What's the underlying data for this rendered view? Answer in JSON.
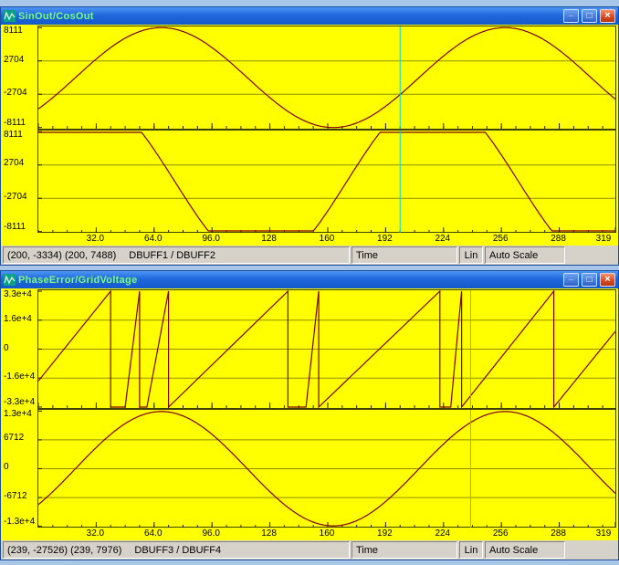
{
  "colors": {
    "desktop_background": "#a8c6e8",
    "titlebar_text": "#7dfc7d",
    "plot_background": "#ffff00",
    "waveform": "#7f0000",
    "grid": "#8f8f00",
    "cursor": "#00dcdc"
  },
  "window_controls": {
    "minimize_glyph": "_",
    "maximize_glyph": "□",
    "close_glyph": "×"
  },
  "windows": [
    {
      "title": "SinOut/CosOut",
      "status": {
        "cursor_readout": "(200, -3334) (200, 7488)",
        "buffers": "DBUFF1 / DBUFF2",
        "domain_mode": "Time",
        "scale_mode": "Lin",
        "autoscale_mode": "Auto Scale"
      }
    },
    {
      "title": "PhaseError/GridVoltage",
      "status": {
        "cursor_readout": "(239, -27526) (239, 7976)",
        "buffers": "DBUFF3 / DBUFF4",
        "domain_mode": "Time",
        "scale_mode": "Lin",
        "autoscale_mode": "Auto Scale"
      }
    }
  ],
  "chart_data": [
    {
      "type": "line",
      "window": "SinOut/CosOut",
      "subplot": "upper",
      "x_range": [
        0,
        319
      ],
      "y_range": [
        -8300,
        8300
      ],
      "y_ticks": [
        {
          "value": 8111,
          "label": "8111"
        },
        {
          "value": 2704,
          "label": "2704"
        },
        {
          "value": -2704,
          "label": "-2704"
        },
        {
          "value": -8111,
          "label": "-8111"
        }
      ],
      "grid_values": [
        2704,
        -2704
      ],
      "x_minor_step": 8,
      "x_major_step": 32,
      "cursor_x": 200,
      "grid_color": "#8f8f00",
      "cursor_color": "#00dcdc",
      "series": [
        {
          "name": "DBUFF1",
          "color": "#7f0000",
          "waveform": {
            "shape": "cosine",
            "amplitude": 8111,
            "period": 190,
            "peak_x": 68
          }
        }
      ]
    },
    {
      "type": "line",
      "window": "SinOut/CosOut",
      "subplot": "lower",
      "x_range": [
        0,
        319
      ],
      "y_range": [
        -8300,
        8300
      ],
      "y_ticks": [
        {
          "value": 8111,
          "label": "8111"
        },
        {
          "value": 2704,
          "label": "2704"
        },
        {
          "value": -2704,
          "label": "-2704"
        },
        {
          "value": -8111,
          "label": "-8111"
        }
      ],
      "grid_values": [
        2704,
        -2704
      ],
      "x_minor_step": 8,
      "cursor_x": 200,
      "grid_color": "#8f8f00",
      "cursor_color": "#00dcdc",
      "x_ticks": [
        {
          "value": 32,
          "label": "32.0"
        },
        {
          "value": 64,
          "label": "64.0"
        },
        {
          "value": 96,
          "label": "96.0"
        },
        {
          "value": 128,
          "label": "128"
        },
        {
          "value": 160,
          "label": "160"
        },
        {
          "value": 192,
          "label": "192"
        },
        {
          "value": 224,
          "label": "224"
        },
        {
          "value": 256,
          "label": "256"
        },
        {
          "value": 288,
          "label": "288"
        },
        {
          "value": 319,
          "label": "319"
        }
      ],
      "series": [
        {
          "name": "DBUFF2",
          "color": "#7f0000",
          "waveform": {
            "shape": "cosine",
            "amplitude": 14000,
            "period": 190,
            "peak_x": 28,
            "clip": 8000
          }
        }
      ]
    },
    {
      "type": "line",
      "window": "PhaseError/GridVoltage",
      "subplot": "upper",
      "x_range": [
        0,
        319
      ],
      "y_range": [
        -33300,
        33300
      ],
      "y_ticks": [
        {
          "value": 32768,
          "label": "3.3e+4"
        },
        {
          "value": 16384,
          "label": "1.6e+4"
        },
        {
          "value": 0,
          "label": "0"
        },
        {
          "value": -16384,
          "label": "-1.6e+4"
        },
        {
          "value": -32768,
          "label": "-3.3e+4"
        }
      ],
      "grid_values": [
        16384,
        0,
        -16384
      ],
      "x_minor_step": 8,
      "x_major_step": 32,
      "cursor_x": 239,
      "grid_color": "#8f8f00",
      "cursor_color": "#00dcdc",
      "series": [
        {
          "name": "DBUFF3",
          "color": "#7f0000",
          "points": [
            [
              0,
              -18000
            ],
            [
              40,
              32768
            ],
            [
              40,
              -32768
            ],
            [
              48,
              -32768
            ],
            [
              56,
              32768
            ],
            [
              56,
              -32768
            ],
            [
              60,
              -32768
            ],
            [
              72,
              32768
            ],
            [
              72,
              -32768
            ],
            [
              138,
              32768
            ],
            [
              138,
              -32768
            ],
            [
              148,
              -32768
            ],
            [
              155,
              32768
            ],
            [
              155,
              -32768
            ],
            [
              222,
              32768
            ],
            [
              222,
              -32768
            ],
            [
              228,
              -32768
            ],
            [
              234,
              32768
            ],
            [
              234,
              -32768
            ],
            [
              285,
              32768
            ],
            [
              285,
              -32768
            ],
            [
              319,
              10000
            ]
          ]
        }
      ]
    },
    {
      "type": "line",
      "window": "PhaseError/GridVoltage",
      "subplot": "lower",
      "x_range": [
        0,
        319
      ],
      "y_range": [
        -13700,
        13700
      ],
      "y_ticks": [
        {
          "value": 13424,
          "label": "1.3e+4"
        },
        {
          "value": 6712,
          "label": "6712"
        },
        {
          "value": 0,
          "label": "0"
        },
        {
          "value": -6712,
          "label": "-6712"
        },
        {
          "value": -13424,
          "label": "-1.3e+4"
        }
      ],
      "grid_values": [
        6712,
        0,
        -6712
      ],
      "x_minor_step": 8,
      "cursor_x": 239,
      "grid_color": "#8f8f00",
      "cursor_color": "#00dcdc",
      "x_ticks": [
        {
          "value": 32,
          "label": "32.0"
        },
        {
          "value": 64,
          "label": "64.0"
        },
        {
          "value": 96,
          "label": "96.0"
        },
        {
          "value": 128,
          "label": "128"
        },
        {
          "value": 160,
          "label": "160"
        },
        {
          "value": 192,
          "label": "192"
        },
        {
          "value": 224,
          "label": "224"
        },
        {
          "value": 256,
          "label": "256"
        },
        {
          "value": 288,
          "label": "288"
        },
        {
          "value": 319,
          "label": "319"
        }
      ],
      "series": [
        {
          "name": "DBUFF4",
          "color": "#7f0000",
          "waveform": {
            "shape": "cosine",
            "amplitude": 13300,
            "period": 190,
            "peak_x": 68
          }
        }
      ]
    }
  ]
}
